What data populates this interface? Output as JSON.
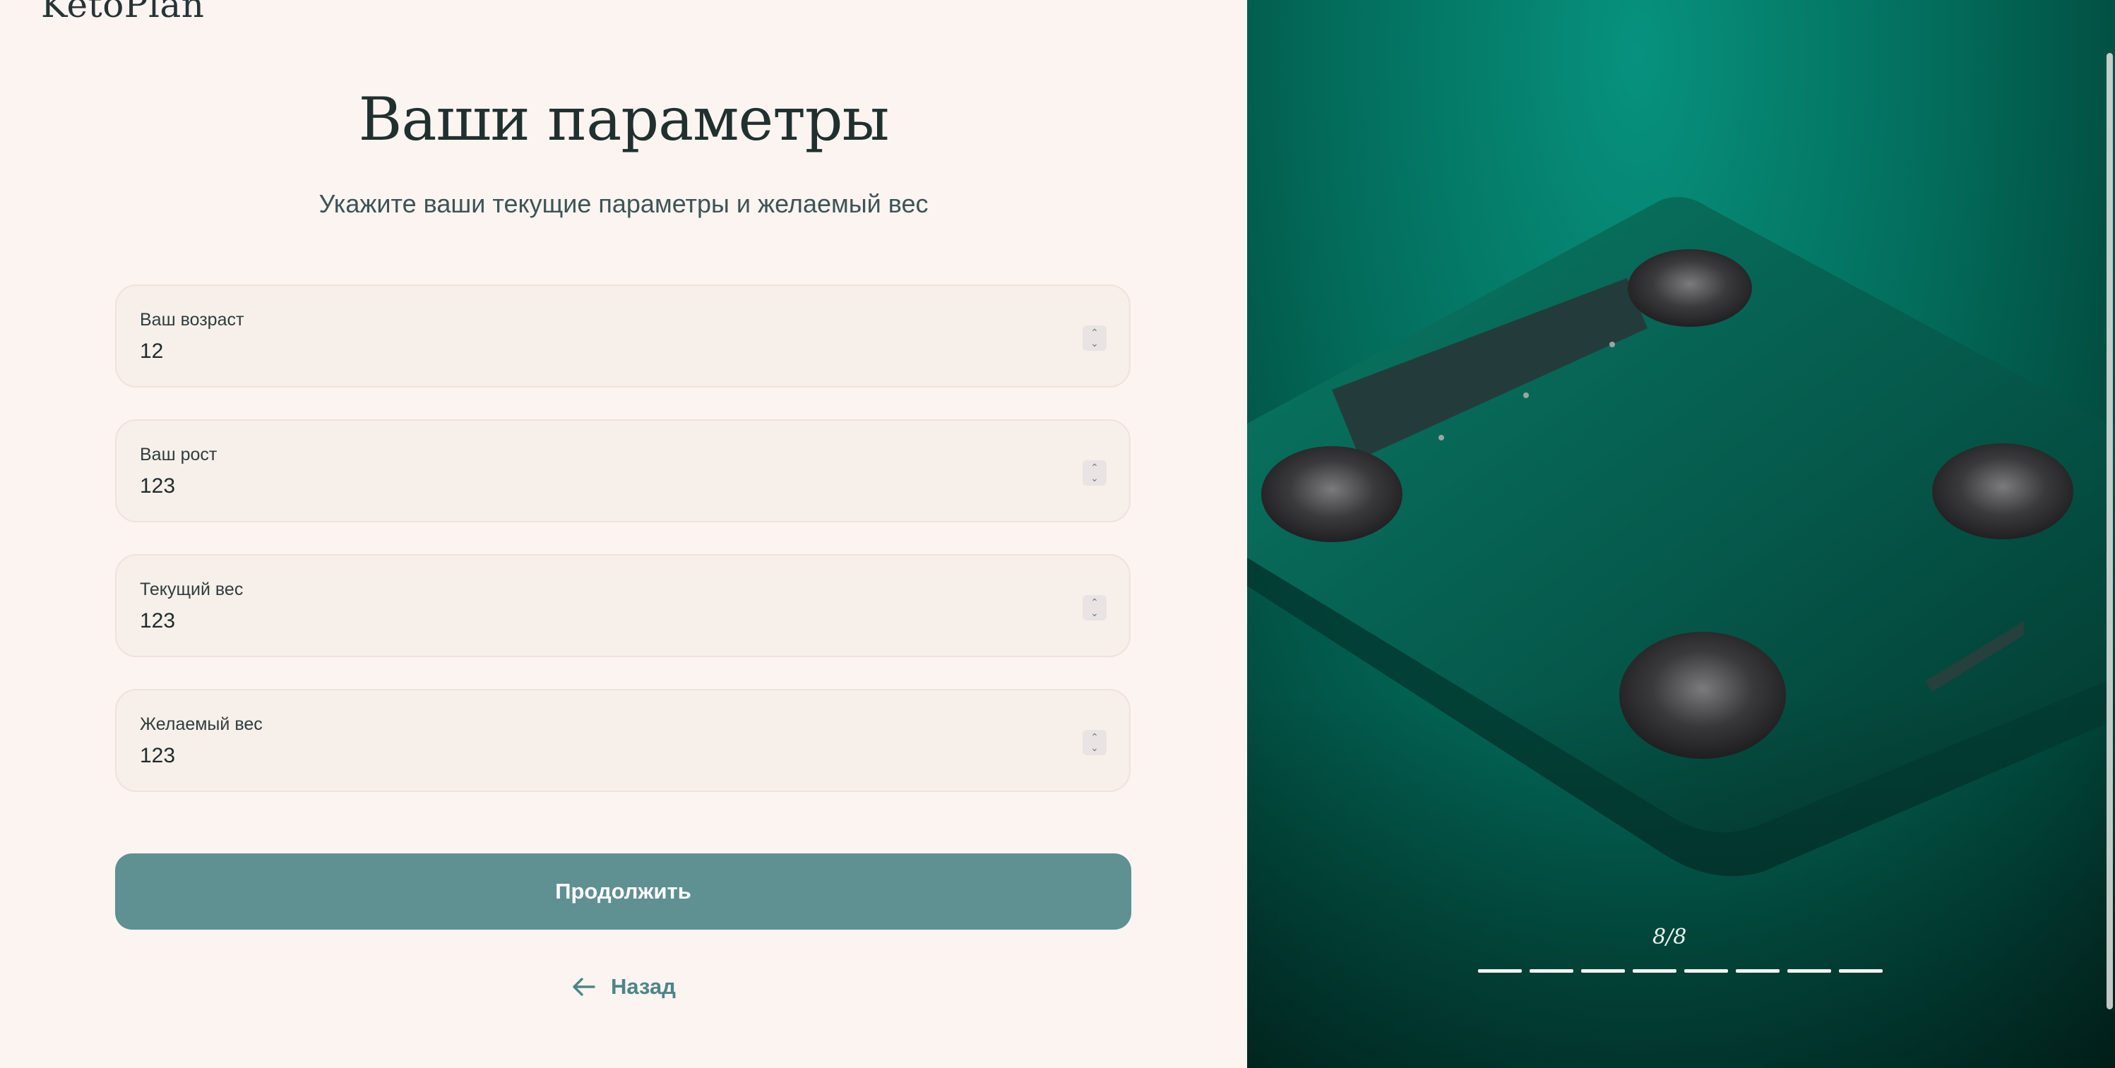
{
  "app": {
    "logo": "KetoPlan"
  },
  "page": {
    "title": "Ваши параметры",
    "subtitle": "Укажите ваши текущие параметры и желаемый вес"
  },
  "fields": [
    {
      "label": "Ваш возраст",
      "value": "12"
    },
    {
      "label": "Ваш рост",
      "value": "123"
    },
    {
      "label": "Текущий вес",
      "value": "123"
    },
    {
      "label": "Желаемый вес",
      "value": "123"
    }
  ],
  "actions": {
    "continue_label": "Продолжить",
    "back_label": "Назад"
  },
  "slideshow": {
    "counter": "8/8",
    "current": 8,
    "total": 8,
    "image": "smart-bathroom-scale-photo"
  },
  "colors": {
    "accent": "#5f9092",
    "background": "#fcf4f1",
    "panel": "#036c5b"
  }
}
